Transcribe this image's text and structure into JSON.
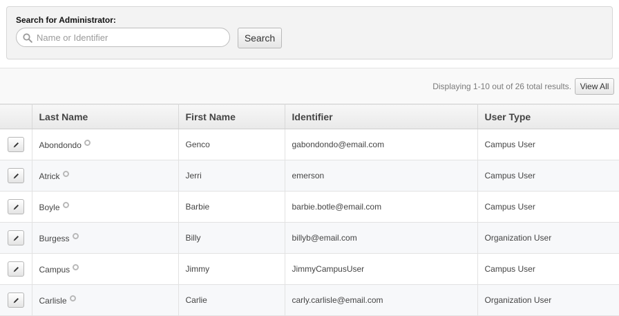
{
  "search": {
    "label": "Search for Administrator:",
    "placeholder": "Name or Identifier",
    "button_label": "Search"
  },
  "results": {
    "summary": "Displaying 1-10 out of 26 total results.",
    "view_all_label": "View All"
  },
  "table": {
    "headers": {
      "last_name": "Last Name",
      "first_name": "First Name",
      "identifier": "Identifier",
      "user_type": "User Type"
    },
    "rows": [
      {
        "last_name": "Abondondo",
        "first_name": "Genco",
        "identifier": "gabondondo@email.com",
        "user_type": "Campus User"
      },
      {
        "last_name": "Atrick",
        "first_name": "Jerri",
        "identifier": "emerson",
        "user_type": "Campus User"
      },
      {
        "last_name": "Boyle",
        "first_name": "Barbie",
        "identifier": "barbie.botle@email.com",
        "user_type": "Campus User"
      },
      {
        "last_name": "Burgess",
        "first_name": "Billy",
        "identifier": "billyb@email.com",
        "user_type": "Organization User"
      },
      {
        "last_name": "Campus",
        "first_name": "Jimmy",
        "identifier": "JimmyCampusUser",
        "user_type": "Campus User"
      },
      {
        "last_name": "Carlisle",
        "first_name": "Carlie",
        "identifier": "carly.carlisle@email.com",
        "user_type": "Organization User"
      }
    ]
  },
  "icons": {
    "search": "search-icon",
    "edit": "pencil-icon",
    "status": "status-circle-icon"
  }
}
